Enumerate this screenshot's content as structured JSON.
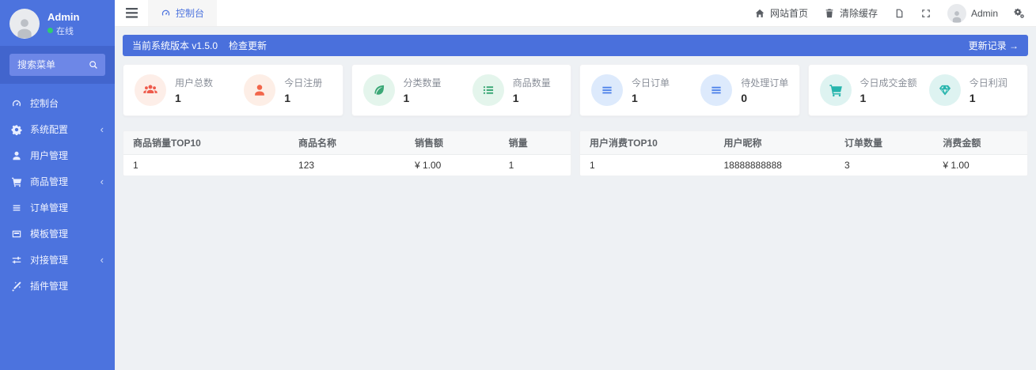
{
  "colors": {
    "sidebar": "#4c73de",
    "notice_bar": "#4a70dc",
    "stat_red": "#ee5b4c",
    "stat_orange": "#f2664a",
    "stat_green": "#3ca877",
    "stat_blue": "#4f83ea",
    "stat_teal": "#27b5ad",
    "online_dot": "#2ecc71",
    "main_background": "#eef1f4"
  },
  "sidebar": {
    "user": {
      "name": "Admin",
      "status": "在线"
    },
    "search_placeholder": "搜索菜单",
    "items": [
      {
        "label": "控制台",
        "icon": "dashboard-icon",
        "active": true
      },
      {
        "label": "系统配置",
        "icon": "gear-icon",
        "chevron": "‹"
      },
      {
        "label": "用户管理",
        "icon": "user-icon"
      },
      {
        "label": "商品管理",
        "icon": "cart-icon",
        "chevron": "‹"
      },
      {
        "label": "订单管理",
        "icon": "list-icon"
      },
      {
        "label": "模板管理",
        "icon": "template-icon"
      },
      {
        "label": "对接管理",
        "icon": "sliders-icon",
        "chevron": "‹"
      },
      {
        "label": "插件管理",
        "icon": "wand-icon"
      }
    ]
  },
  "topbar": {
    "tab": "控制台",
    "home_label": "网站首页",
    "clear_cache_label": "清除缓存",
    "user_label": "Admin"
  },
  "notice": {
    "version_text": "当前系统版本 v1.5.0",
    "check_update_label": "检查更新",
    "update_log_label": "更新记录 →"
  },
  "stats": [
    {
      "label": "用户总数",
      "value": "1",
      "icon": "users-icon"
    },
    {
      "label": "今日注册",
      "value": "1",
      "icon": "user-icon"
    },
    {
      "label": "分类数量",
      "value": "1",
      "icon": "leaf-icon"
    },
    {
      "label": "商品数量",
      "value": "1",
      "icon": "bullet-list-icon"
    },
    {
      "label": "今日订单",
      "value": "1",
      "icon": "list-icon"
    },
    {
      "label": "待处理订单",
      "value": "0",
      "icon": "list-icon"
    },
    {
      "label": "今日成交金额",
      "value": "1",
      "icon": "cart-icon"
    },
    {
      "label": "今日利润",
      "value": "1",
      "icon": "gem-icon"
    }
  ],
  "tables": {
    "products": {
      "headers": [
        "商品销量TOP10",
        "商品名称",
        "销售额",
        "销量"
      ],
      "rows": [
        [
          "1",
          "123",
          "¥ 1.00",
          "1"
        ]
      ]
    },
    "users": {
      "headers": [
        "用户消费TOP10",
        "用户昵称",
        "订单数量",
        "消费金额"
      ],
      "rows": [
        [
          "1",
          "18888888888",
          "3",
          "¥ 1.00"
        ]
      ]
    }
  }
}
